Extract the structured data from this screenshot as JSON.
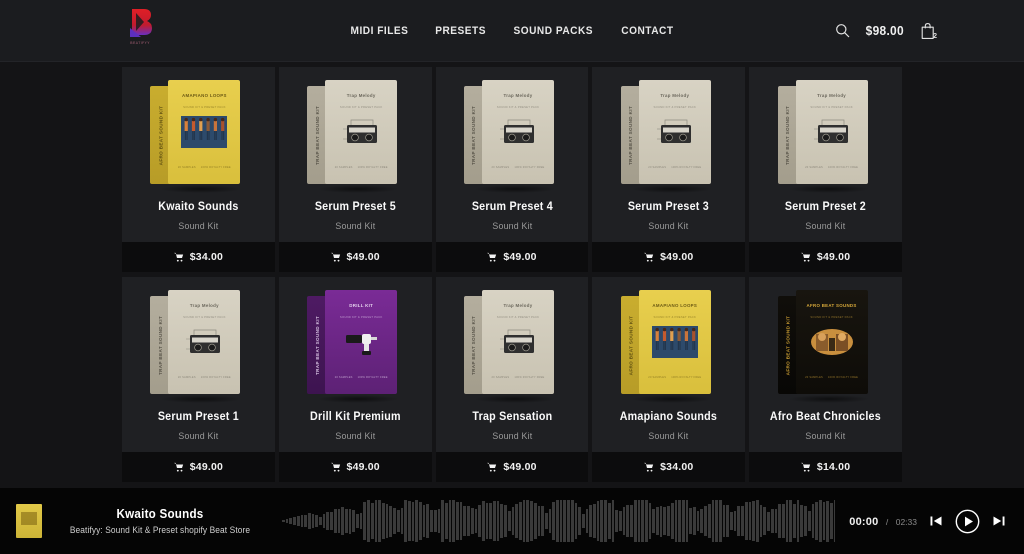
{
  "header": {
    "logo": {
      "name": "beatifyy-logo",
      "caption": "BEATIFYY"
    },
    "nav": [
      {
        "label": "MIDI FILES"
      },
      {
        "label": "PRESETS"
      },
      {
        "label": "SOUND PACKS"
      },
      {
        "label": "CONTACT"
      }
    ],
    "search_icon": "search-icon",
    "cart_total": "$98.00",
    "cart_icon": "shopping-bag-icon",
    "cart_count": "2"
  },
  "products": [
    {
      "title": "Kwaito Sounds",
      "subtitle": "Sound Kit",
      "price": "$34.00",
      "art": {
        "theme": "theme-yellow",
        "spine": "AFRO BEAT SOUND KIT",
        "top": "AMAPIANO LOOPS",
        "sub": "SOUND KIT & PRESET PACK",
        "img": "dancers-illustration",
        "b1": "20 SAMPLES",
        "b2": "100% ROYALTY FREE"
      }
    },
    {
      "title": "Serum Preset 5",
      "subtitle": "Sound Kit",
      "price": "$49.00",
      "art": {
        "theme": "theme-beige",
        "spine": "TRAP BEAT SOUND KIT",
        "top": "Trap Melody",
        "sub": "SOUND KIT & PRESET PACK",
        "img": "boombox-illustration",
        "b1": "20 SAMPLES",
        "b2": "100% ROYALTY FREE"
      }
    },
    {
      "title": "Serum Preset 4",
      "subtitle": "Sound Kit",
      "price": "$49.00",
      "art": {
        "theme": "theme-beige",
        "spine": "TRAP BEAT SOUND KIT",
        "top": "Trap Melody",
        "sub": "SOUND KIT & PRESET PACK",
        "img": "boombox-illustration",
        "b1": "20 SAMPLES",
        "b2": "100% ROYALTY FREE"
      }
    },
    {
      "title": "Serum Preset 3",
      "subtitle": "Sound Kit",
      "price": "$49.00",
      "art": {
        "theme": "theme-beige",
        "spine": "TRAP BEAT SOUND KIT",
        "top": "Trap Melody",
        "sub": "SOUND KIT & PRESET PACK",
        "img": "boombox-illustration",
        "b1": "20 SAMPLES",
        "b2": "100% ROYALTY FREE"
      }
    },
    {
      "title": "Serum Preset 2",
      "subtitle": "Sound Kit",
      "price": "$49.00",
      "art": {
        "theme": "theme-beige",
        "spine": "TRAP BEAT SOUND KIT",
        "top": "Trap Melody",
        "sub": "SOUND KIT & PRESET PACK",
        "img": "boombox-illustration",
        "b1": "20 SAMPLES",
        "b2": "100% ROYALTY FREE"
      }
    },
    {
      "title": "Serum Preset 1",
      "subtitle": "Sound Kit",
      "price": "$49.00",
      "art": {
        "theme": "theme-beige",
        "spine": "TRAP BEAT SOUND KIT",
        "top": "Trap Melody",
        "sub": "SOUND KIT & PRESET PACK",
        "img": "boombox-illustration",
        "b1": "20 SAMPLES",
        "b2": "100% ROYALTY FREE"
      }
    },
    {
      "title": "Drill Kit Premium",
      "subtitle": "Sound Kit",
      "price": "$49.00",
      "art": {
        "theme": "theme-purple",
        "spine": "TRAP BEAT SOUND KIT",
        "top": "DRILL KIT",
        "sub": "SOUND KIT & PRESET PACK",
        "img": "drill-illustration",
        "b1": "20 SAMPLES",
        "b2": "100% ROYALTY FREE"
      }
    },
    {
      "title": "Trap Sensation",
      "subtitle": "Sound Kit",
      "price": "$49.00",
      "art": {
        "theme": "theme-beige",
        "spine": "TRAP BEAT SOUND KIT",
        "top": "Trap Melody",
        "sub": "SOUND KIT & PRESET PACK",
        "img": "boombox-illustration",
        "b1": "20 SAMPLES",
        "b2": "100% ROYALTY FREE"
      }
    },
    {
      "title": "Amapiano Sounds",
      "subtitle": "Sound Kit",
      "price": "$34.00",
      "art": {
        "theme": "theme-yellow",
        "spine": "AFRO BEAT SOUND KIT",
        "top": "AMAPIANO LOOPS",
        "sub": "SOUND KIT & PRESET PACK",
        "img": "dancers-illustration",
        "b1": "20 SAMPLES",
        "b2": "100% ROYALTY FREE"
      }
    },
    {
      "title": "Afro Beat Chronicles",
      "subtitle": "Sound Kit",
      "price": "$14.00",
      "art": {
        "theme": "theme-black",
        "spine": "AFRO BEAT SOUND KIT",
        "top": "AFRO BEAT SOUNDS",
        "sub": "SOUND KIT & PRESET PACK",
        "img": "faces-illustration",
        "b1": "20 SAMPLES",
        "b2": "100% ROYALTY FREE"
      }
    }
  ],
  "player": {
    "thumb": "track-artwork",
    "track_title": "Kwaito Sounds",
    "track_desc": "Beatifyy: Sound Kit & Preset shopify Beat Store",
    "waveform": "audio-waveform",
    "current_time": "00:00",
    "time_separator": "/",
    "total_time": "02:33",
    "prev_icon": "previous-track-icon",
    "play_icon": "play-icon",
    "next_icon": "next-track-icon"
  }
}
